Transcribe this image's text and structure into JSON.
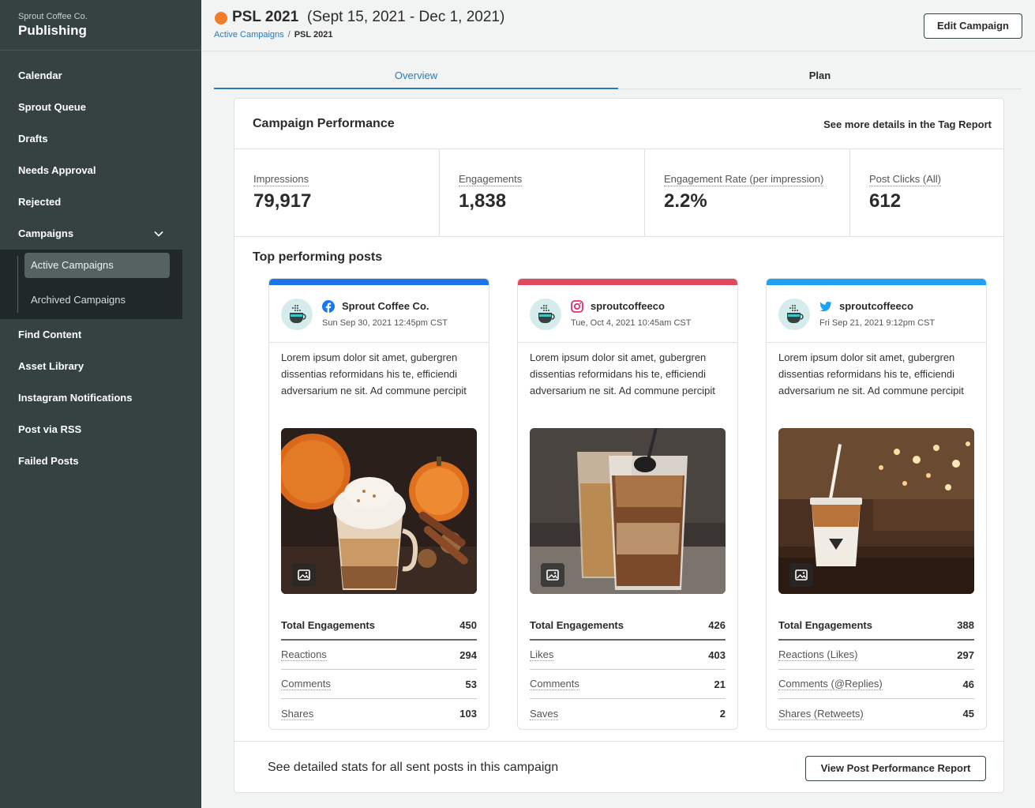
{
  "sidebar": {
    "org": "Sprout Coffee Co.",
    "app": "Publishing",
    "items": [
      {
        "label": "Calendar"
      },
      {
        "label": "Sprout Queue"
      },
      {
        "label": "Drafts"
      },
      {
        "label": "Needs Approval"
      },
      {
        "label": "Rejected"
      },
      {
        "label": "Campaigns"
      }
    ],
    "sub_items": [
      {
        "label": "Active Campaigns",
        "active": true
      },
      {
        "label": "Archived Campaigns",
        "active": false
      }
    ],
    "items_after": [
      {
        "label": "Find Content"
      },
      {
        "label": "Asset Library"
      },
      {
        "label": "Instagram Notifications"
      },
      {
        "label": "Post via RSS"
      },
      {
        "label": "Failed Posts"
      }
    ]
  },
  "header": {
    "title": "PSL 2021",
    "dates": "(Sept 15, 2021 - Dec 1, 2021)",
    "breadcrumb": {
      "parent": "Active Campaigns",
      "separator": "/",
      "current": "PSL 2021"
    },
    "edit_label": "Edit Campaign",
    "campaign_color": "#f17d2a"
  },
  "tabs": [
    {
      "label": "Overview",
      "active": true
    },
    {
      "label": "Plan",
      "active": false
    }
  ],
  "panel": {
    "title": "Campaign Performance",
    "tag_link": "See more details in the Tag Report",
    "stats": [
      {
        "label": "Impressions",
        "value": "79,917"
      },
      {
        "label": "Engagements",
        "value": "1,838"
      },
      {
        "label": "Engagement Rate (per impression)",
        "value": "2.2%"
      },
      {
        "label": "Post Clicks (All)",
        "value": "612"
      }
    ],
    "top_title": "Top performing posts",
    "posts": [
      {
        "network": "facebook",
        "network_icon": "facebook-icon",
        "bar_color": "#1f72e8",
        "account": "Sprout Coffee Co.",
        "time": "Sun Sep 30, 2021 12:45pm CST",
        "text": "Lorem ipsum dolor sit amet, gubergren dissentias reformidans his te, efficiendi adversarium ne sit. Ad commune percipit",
        "metrics": [
          {
            "label": "Total Engagements",
            "value": "450"
          },
          {
            "label": "Reactions",
            "value": "294"
          },
          {
            "label": "Comments",
            "value": "53"
          },
          {
            "label": "Shares",
            "value": "103"
          }
        ]
      },
      {
        "network": "instagram",
        "network_icon": "instagram-icon",
        "bar_color": "#e04a5f",
        "account": "sproutcoffeeco",
        "time": "Tue, Oct 4, 2021 10:45am CST",
        "text": "Lorem ipsum dolor sit amet, gubergren dissentias reformidans his te, efficiendi adversarium ne sit. Ad commune percipit",
        "metrics": [
          {
            "label": "Total Engagements",
            "value": "426"
          },
          {
            "label": "Likes",
            "value": "403"
          },
          {
            "label": "Comments",
            "value": "21"
          },
          {
            "label": "Saves",
            "value": "2"
          }
        ]
      },
      {
        "network": "twitter",
        "network_icon": "twitter-icon",
        "bar_color": "#1da1f2",
        "account": "sproutcoffeeco",
        "time": "Fri Sep 21, 2021 9:12pm CST",
        "text": "Lorem ipsum dolor sit amet, gubergren dissentias reformidans his te, efficiendi adversarium ne sit. Ad commune percipit",
        "metrics": [
          {
            "label": "Total Engagements",
            "value": "388"
          },
          {
            "label": "Reactions (Likes)",
            "value": "297"
          },
          {
            "label": "Comments (@Replies)",
            "value": "46"
          },
          {
            "label": "Shares (Retweets)",
            "value": "45"
          }
        ]
      }
    ],
    "footer_text": "See detailed stats for all sent posts in this campaign",
    "report_label": "View Post Performance Report"
  }
}
